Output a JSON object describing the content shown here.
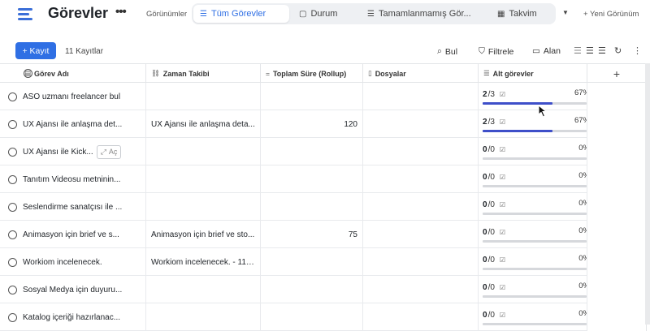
{
  "app": {
    "title": "Görevler",
    "more": "•••",
    "views_label": "Görünümler",
    "new_view": "+ Yeni Görünüm"
  },
  "tabs": [
    {
      "icon": "list-icon",
      "glyph": "☰",
      "label": "Tüm Görevler",
      "active": true
    },
    {
      "icon": "board-icon",
      "glyph": "▢",
      "label": "Durum",
      "active": false
    },
    {
      "icon": "list-icon",
      "glyph": "☰",
      "label": "Tamamlanmamış Gör...",
      "active": false
    },
    {
      "icon": "calendar-icon",
      "glyph": "▦",
      "label": "Takvim",
      "active": false
    }
  ],
  "toolbar": {
    "add_label": "+ Kayıt",
    "records": "11 Kayıtlar",
    "find": "Bul",
    "filter": "Filtrele",
    "field": "Alan"
  },
  "columns": [
    {
      "icon": "database-icon",
      "glyph": "▤",
      "label": "Görev Adı"
    },
    {
      "icon": "link-icon",
      "glyph": "🔗",
      "label": "Zaman Takibi"
    },
    {
      "icon": "rollup-icon",
      "glyph": "=",
      "label": "Toplam Süre (Rollup)"
    },
    {
      "icon": "file-icon",
      "glyph": "▯",
      "label": "Dosyalar"
    },
    {
      "icon": "subtask-icon",
      "glyph": "☰",
      "label": "Alt görevler"
    }
  ],
  "add_column": "+",
  "open_label": "Aç",
  "rows": [
    {
      "name": "ASO uzmanı freelancer bul",
      "time": "",
      "total": "",
      "files": "",
      "done": "2",
      "total_sub": "/3",
      "pct": "67%",
      "progress": 0.67
    },
    {
      "name": "UX Ajansı ile anlaşma det...",
      "time": "UX Ajansı ile anlaşma deta...",
      "total": "120",
      "files": "",
      "done": "2",
      "total_sub": "/3",
      "pct": "67%",
      "progress": 0.67
    },
    {
      "name": "UX Ajansı ile Kick...",
      "time": "",
      "total": "",
      "files": "",
      "done": "0",
      "total_sub": "/0",
      "pct": "0%",
      "progress": 0,
      "hover": true
    },
    {
      "name": "Tanıtım Videosu metninin...",
      "time": "",
      "total": "",
      "files": "",
      "done": "0",
      "total_sub": "/0",
      "pct": "0%",
      "progress": 0
    },
    {
      "name": "Seslendirme sanatçısı ile ...",
      "time": "",
      "total": "",
      "files": "",
      "done": "0",
      "total_sub": "/0",
      "pct": "0%",
      "progress": 0
    },
    {
      "name": "Animasyon için brief ve s...",
      "time": "Animasyon için brief ve sto...",
      "total": "75",
      "files": "",
      "done": "0",
      "total_sub": "/0",
      "pct": "0%",
      "progress": 0
    },
    {
      "name": "Workiom incelenecek.",
      "time": "Workiom incelenecek. - 11.1...",
      "total": "",
      "files": "",
      "done": "0",
      "total_sub": "/0",
      "pct": "0%",
      "progress": 0
    },
    {
      "name": "Sosyal Medya için duyuru...",
      "time": "",
      "total": "",
      "files": "",
      "done": "0",
      "total_sub": "/0",
      "pct": "0%",
      "progress": 0
    },
    {
      "name": "Katalog içeriği hazırlanac...",
      "time": "",
      "total": "",
      "files": "",
      "done": "0",
      "total_sub": "/0",
      "pct": "0%",
      "progress": 0
    }
  ],
  "colors": {
    "accent": "#2f6fe4",
    "progress": "#3e4fc9"
  }
}
